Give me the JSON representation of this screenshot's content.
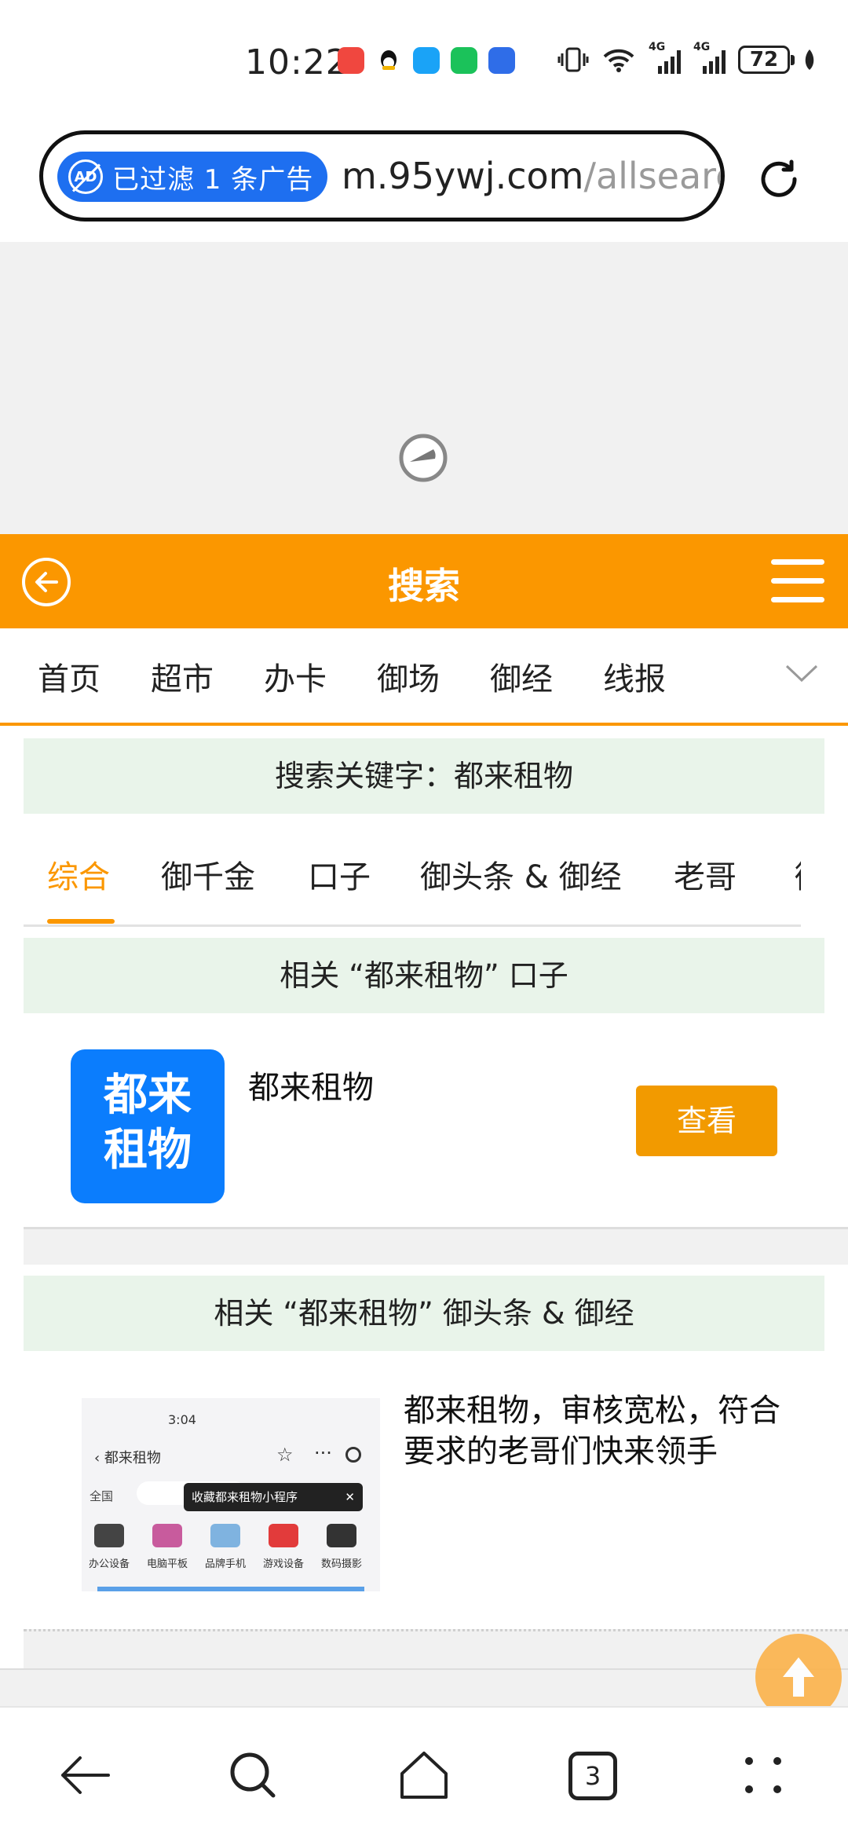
{
  "status_bar": {
    "time": "10:22",
    "battery": "72",
    "network_1": "4G",
    "network_2": "4G",
    "app_icons": [
      "missed-call-icon",
      "qq-icon",
      "message-icon",
      "wechat-icon",
      "task-icon"
    ]
  },
  "browser": {
    "ad_filter_label": "已过滤 1 条广告",
    "ad_icon_text": "AD",
    "url_domain": "m.95ywj.com",
    "url_path": "/allsearcl"
  },
  "header": {
    "title": "搜索"
  },
  "nav": {
    "items": [
      "首页",
      "超市",
      "办卡",
      "御场",
      "御经",
      "线报"
    ]
  },
  "search": {
    "keyword_text": "搜索关键字：都来租物"
  },
  "tabs": {
    "items": [
      "综合",
      "御千金",
      "口子",
      "御头条 & 御经",
      "老哥",
      "御"
    ],
    "active_index": 0
  },
  "section_kouzi": {
    "title": "相关 “都来租物” 口子",
    "app": {
      "logo_line1": "都来",
      "logo_line2": "租物",
      "name": "都来租物",
      "button_label": "查看"
    }
  },
  "section_news": {
    "title": "相关 “都来租物” 御头条 & 御经",
    "article": {
      "text": "都来租物，审核宽松，符合要求的老哥们快来领手",
      "thumbnail": {
        "time": "3:04",
        "title": "都来租物",
        "region": "全国",
        "tooltip": "收藏都来租物小程序",
        "categories": [
          "办公设备",
          "电脑平板",
          "品牌手机",
          "游戏设备",
          "数码摄影"
        ]
      }
    }
  },
  "bottom_bar": {
    "tab_count": "3"
  },
  "colors": {
    "brand_orange": "#fb9700",
    "button_orange": "#f29a00",
    "ad_blue": "#1e6ff0",
    "logo_blue": "#0b7dfd",
    "section_green": "#e9f4ea"
  }
}
